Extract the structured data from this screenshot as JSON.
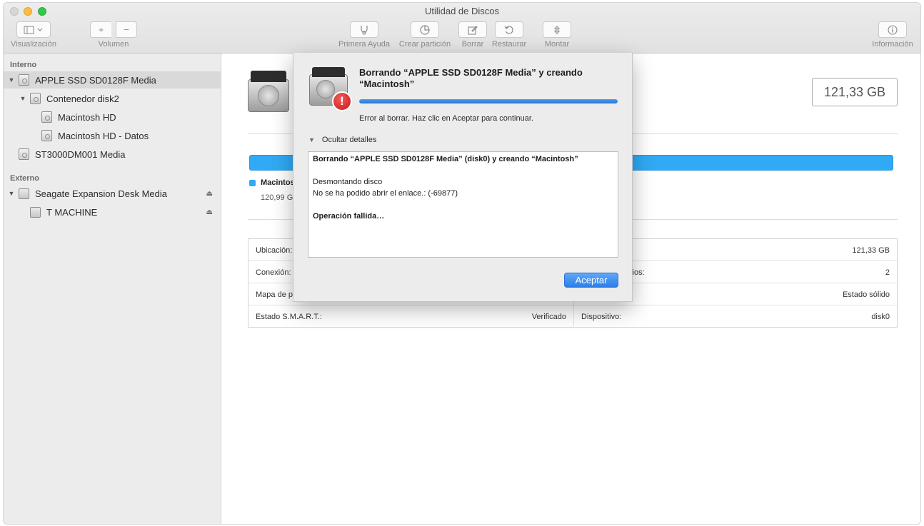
{
  "window": {
    "title": "Utilidad de Discos"
  },
  "toolbar": {
    "view_label": "Visualización",
    "volume_label": "Volumen",
    "volume_add": "+",
    "volume_remove": "−",
    "first_aid_label": "Primera Ayuda",
    "partition_label": "Crear partición",
    "erase_label": "Borrar",
    "restore_label": "Restaurar",
    "mount_label": "Montar",
    "info_label": "Información"
  },
  "sidebar": {
    "internal_header": "Interno",
    "external_header": "Externo",
    "internal_items": [
      {
        "label": "APPLE SSD SD0128F Media"
      },
      {
        "label": "Contenedor disk2"
      },
      {
        "label": "Macintosh HD"
      },
      {
        "label": "Macintosh HD - Datos"
      },
      {
        "label": "ST3000DM001 Media"
      }
    ],
    "external_items": [
      {
        "label": "Seagate Expansion Desk Media"
      },
      {
        "label": "T MACHINE"
      }
    ]
  },
  "main": {
    "capacity": "121,33 GB",
    "legend": {
      "name": "Macintos",
      "size": "120,99 GE",
      "color": "#30aaf4"
    },
    "info": {
      "rows": [
        {
          "left_label": "Ubicación:",
          "left_value": "",
          "right_label": "",
          "right_value": "121,33 GB"
        },
        {
          "left_label": "Conexión:",
          "left_value": "",
          "right_label": "jetos secundarios:",
          "right_value": "2"
        },
        {
          "left_label": "Mapa de pa",
          "left_value": "",
          "right_label": "",
          "right_value": "Estado sólido"
        },
        {
          "left_label": "Estado S.M.A.R.T.:",
          "left_value": "Verificado",
          "right_label": "Dispositivo:",
          "right_value": "disk0"
        }
      ]
    }
  },
  "dialog": {
    "title": "Borrando “APPLE SSD SD0128F Media” y creando “Macintosh”",
    "progress": 1.0,
    "message": "Error al borrar. Haz clic en Aceptar para continuar.",
    "toggle_label": "Ocultar detalles",
    "log": {
      "line1": "Borrando “APPLE SSD SD0128F Media” (disk0) y creando “Macintosh”",
      "line2": "Desmontando disco",
      "line3": "No se ha podido abrir el enlace.: (-69877)",
      "line4": "Operación fallida…"
    },
    "ok_label": "Aceptar",
    "badge_symbol": "!"
  }
}
